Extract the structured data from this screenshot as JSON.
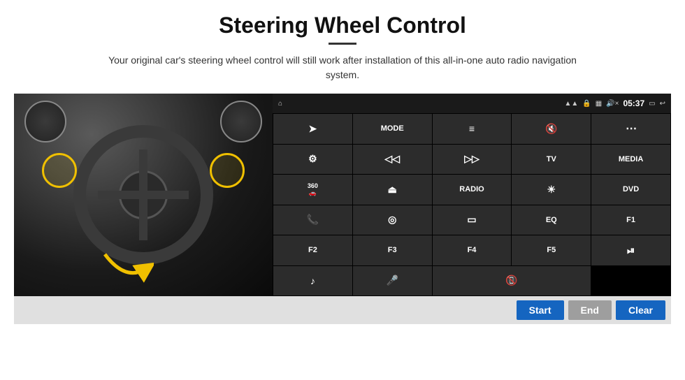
{
  "header": {
    "title": "Steering Wheel Control",
    "divider": true,
    "subtitle": "Your original car's steering wheel control will still work after installation of this all-in-one auto radio navigation system."
  },
  "status_bar": {
    "home_icon": "⌂",
    "wifi_icon": "📶",
    "lock_icon": "🔒",
    "sim_icon": "📱",
    "bt_icon": "🔵",
    "time": "05:37",
    "screen_icon": "▭",
    "back_icon": "↩"
  },
  "control_buttons": [
    {
      "id": "send",
      "icon": "➤",
      "label": ""
    },
    {
      "id": "mode",
      "icon": "",
      "label": "MODE"
    },
    {
      "id": "list",
      "icon": "≡",
      "label": ""
    },
    {
      "id": "mute",
      "icon": "🔇",
      "label": ""
    },
    {
      "id": "apps",
      "icon": "⋯",
      "label": ""
    },
    {
      "id": "settings",
      "icon": "⚙",
      "label": ""
    },
    {
      "id": "prev",
      "icon": "⏮",
      "label": ""
    },
    {
      "id": "next",
      "icon": "⏭",
      "label": ""
    },
    {
      "id": "tv",
      "icon": "",
      "label": "TV"
    },
    {
      "id": "media",
      "icon": "",
      "label": "MEDIA"
    },
    {
      "id": "cam360",
      "icon": "360",
      "label": ""
    },
    {
      "id": "eject",
      "icon": "⏏",
      "label": ""
    },
    {
      "id": "radio",
      "icon": "",
      "label": "RADIO"
    },
    {
      "id": "brightness",
      "icon": "☀",
      "label": ""
    },
    {
      "id": "dvd",
      "icon": "",
      "label": "DVD"
    },
    {
      "id": "phone",
      "icon": "📞",
      "label": ""
    },
    {
      "id": "nav",
      "icon": "🧭",
      "label": ""
    },
    {
      "id": "screen",
      "icon": "▭",
      "label": ""
    },
    {
      "id": "eq",
      "icon": "",
      "label": "EQ"
    },
    {
      "id": "f1",
      "icon": "",
      "label": "F1"
    },
    {
      "id": "f2",
      "icon": "",
      "label": "F2"
    },
    {
      "id": "f3",
      "icon": "",
      "label": "F3"
    },
    {
      "id": "f4",
      "icon": "",
      "label": "F4"
    },
    {
      "id": "f5",
      "icon": "",
      "label": "F5"
    },
    {
      "id": "playpause",
      "icon": "⏯",
      "label": ""
    },
    {
      "id": "music",
      "icon": "♪",
      "label": ""
    },
    {
      "id": "mic",
      "icon": "🎤",
      "label": ""
    },
    {
      "id": "phonecall",
      "icon": "📵",
      "label": ""
    }
  ],
  "bottom_bar": {
    "start_label": "Start",
    "end_label": "End",
    "clear_label": "Clear"
  }
}
